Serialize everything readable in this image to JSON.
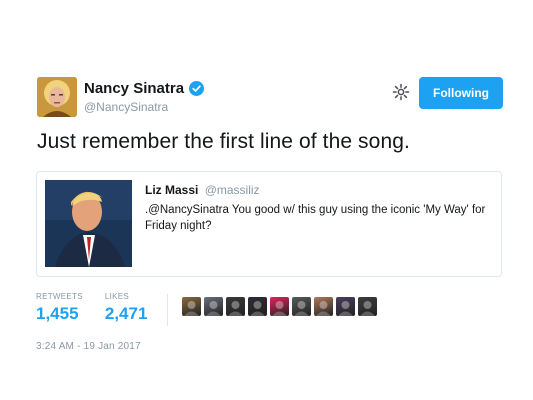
{
  "author": {
    "display_name": "Nancy Sinatra",
    "handle": "@NancySinatra",
    "verified": true,
    "avatar_icon": "profile-photo"
  },
  "actions": {
    "settings_icon": "gear-icon",
    "follow_label": "Following"
  },
  "tweet": {
    "text": "Just remember the first line of the song."
  },
  "quoted_tweet": {
    "display_name": "Liz Massi",
    "handle": "@massiliz",
    "text": ".@NancySinatra You good w/ this guy using the iconic 'My Way' for Friday night?",
    "image_icon": "photo"
  },
  "stats": {
    "retweets_label": "RETWEETS",
    "retweets_count": "1,455",
    "likes_label": "LIKES",
    "likes_count": "2,471"
  },
  "likers": [
    {
      "color": "#8a6a3c"
    },
    {
      "color": "#6b6f7a"
    },
    {
      "color": "#3a3a3a"
    },
    {
      "color": "#2c2c34"
    },
    {
      "color": "#e0245e"
    },
    {
      "color": "#5a5a5a"
    },
    {
      "color": "#b07a5a"
    },
    {
      "color": "#4a3d5c"
    },
    {
      "color": "#3d3d3d"
    }
  ],
  "timestamp": "3:24 AM - 19 Jan 2017",
  "colors": {
    "accent": "#1da1f2",
    "muted": "#8899a6",
    "text": "#14171a",
    "border": "#e1e8ed"
  }
}
